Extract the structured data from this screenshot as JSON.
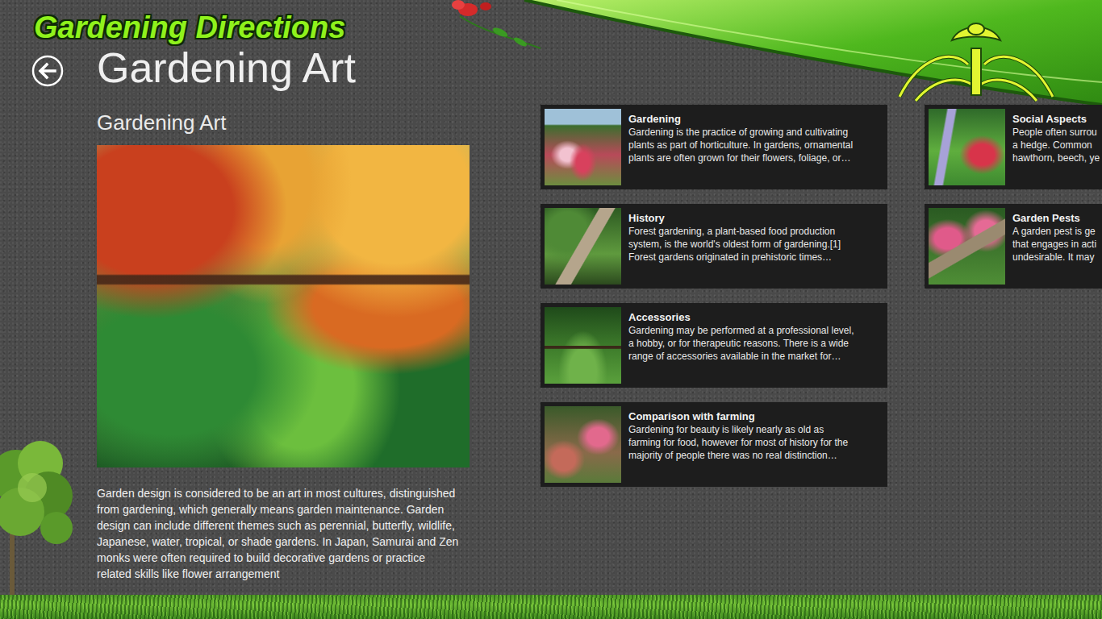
{
  "app": {
    "logo": "Gardening Directions",
    "title": "Gardening Art"
  },
  "article": {
    "heading": "Gardening Art",
    "body_lines": [
      "Garden design is considered to be an art in most cultures, distinguished",
      "from gardening, which generally means garden maintenance. Garden",
      "design can include different themes such as perennial, butterfly, wildlife,",
      "Japanese, water, tropical, or shade gardens. In Japan, Samurai and Zen",
      "monks were often required to build decorative gardens or practice",
      "related skills like flower arrangement"
    ]
  },
  "tiles": [
    {
      "title": "Gardening",
      "lines": [
        "Gardening is the practice of growing and cultivating",
        "plants as part of horticulture. In gardens, ornamental",
        "plants are often grown for their flowers, foliage, or…"
      ]
    },
    {
      "title": "History",
      "lines": [
        "Forest gardening, a plant-based food production",
        "system, is the world's oldest form of gardening.[1]",
        "Forest gardens originated in prehistoric times…"
      ]
    },
    {
      "title": "Accessories",
      "lines": [
        "Gardening may be performed at a professional level,",
        "a hobby, or for therapeutic reasons. There is a wide",
        "range of accessories available in the market for…"
      ]
    },
    {
      "title": "Comparison with farming",
      "lines": [
        "Gardening for beauty is likely nearly as old as",
        "farming for food, however for most of history for the",
        "majority of people there was no real distinction…"
      ]
    },
    {
      "title": "Social Aspects",
      "lines": [
        "People often surrou",
        "a hedge. Common",
        "hawthorn, beech, ye"
      ]
    },
    {
      "title": "Garden Pests",
      "lines": [
        "A garden pest is ge",
        "that engages in acti",
        "undesirable. It may"
      ]
    }
  ]
}
